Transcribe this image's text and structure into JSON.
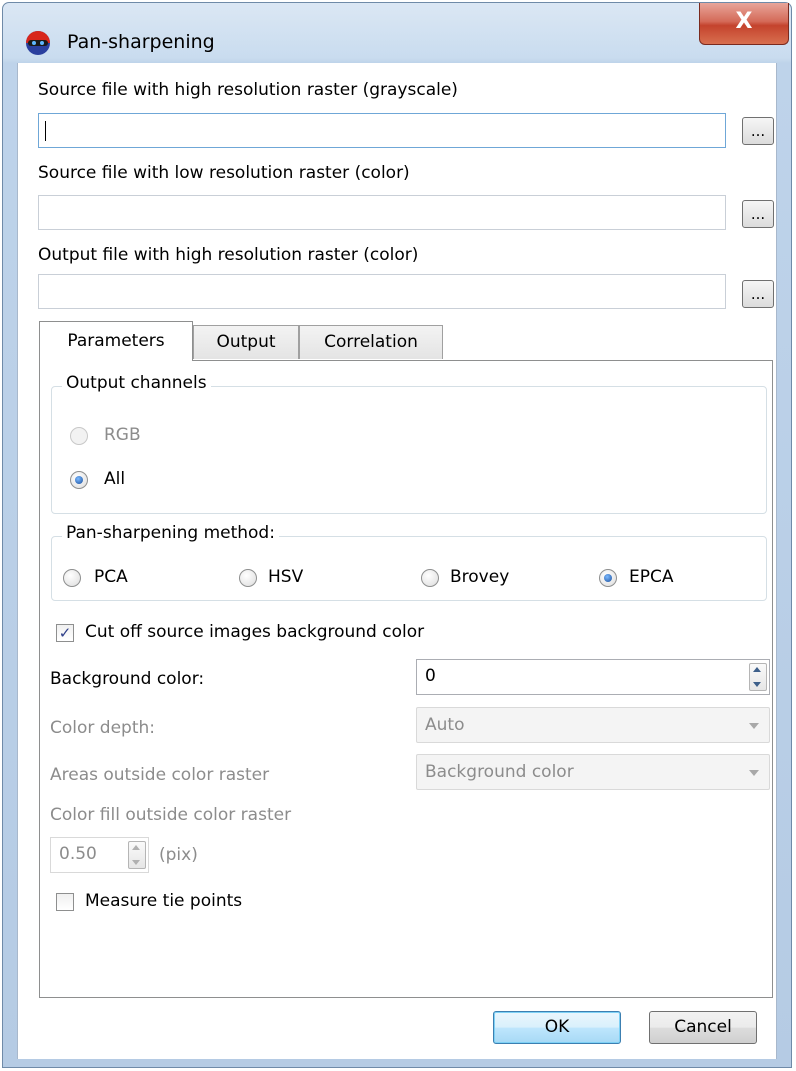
{
  "window": {
    "title": "Pan-sharpening",
    "close_label": "X"
  },
  "inputs": {
    "high_res_label": "Source file with high resolution raster (grayscale)",
    "high_res_value": "",
    "low_res_label": "Source file with low resolution raster (color)",
    "low_res_value": "",
    "output_label": "Output file with high resolution raster (color)",
    "output_value": "",
    "browse_label": "..."
  },
  "tabs": [
    {
      "label": "Parameters",
      "active": true
    },
    {
      "label": "Output",
      "active": false
    },
    {
      "label": "Correlation",
      "active": false
    }
  ],
  "output_channels": {
    "title": "Output channels",
    "options": [
      {
        "label": "RGB",
        "checked": false,
        "disabled": true
      },
      {
        "label": "All",
        "checked": true,
        "disabled": false
      }
    ]
  },
  "method": {
    "title": "Pan-sharpening method:",
    "options": [
      {
        "label": "PCA",
        "checked": false
      },
      {
        "label": "HSV",
        "checked": false
      },
      {
        "label": "Brovey",
        "checked": false
      },
      {
        "label": "EPCA",
        "checked": true
      }
    ]
  },
  "cut_off": {
    "label": "Cut off source images background color",
    "checked": true
  },
  "background_color": {
    "label": "Background color:",
    "value": "0"
  },
  "color_depth": {
    "label": "Color depth:",
    "value": "Auto"
  },
  "areas_outside": {
    "label": "Areas outside color raster",
    "value": "Background color"
  },
  "color_fill": {
    "label": "Color fill outside color raster",
    "value": "0.50",
    "unit": "(pix)"
  },
  "measure_tie": {
    "label": "Measure tie points",
    "checked": false
  },
  "buttons": {
    "ok": "OK",
    "cancel": "Cancel"
  },
  "colors": {
    "title_bar": "#c9dcef",
    "close_button": "#c4432d",
    "ok_border": "#3c7fb1"
  }
}
